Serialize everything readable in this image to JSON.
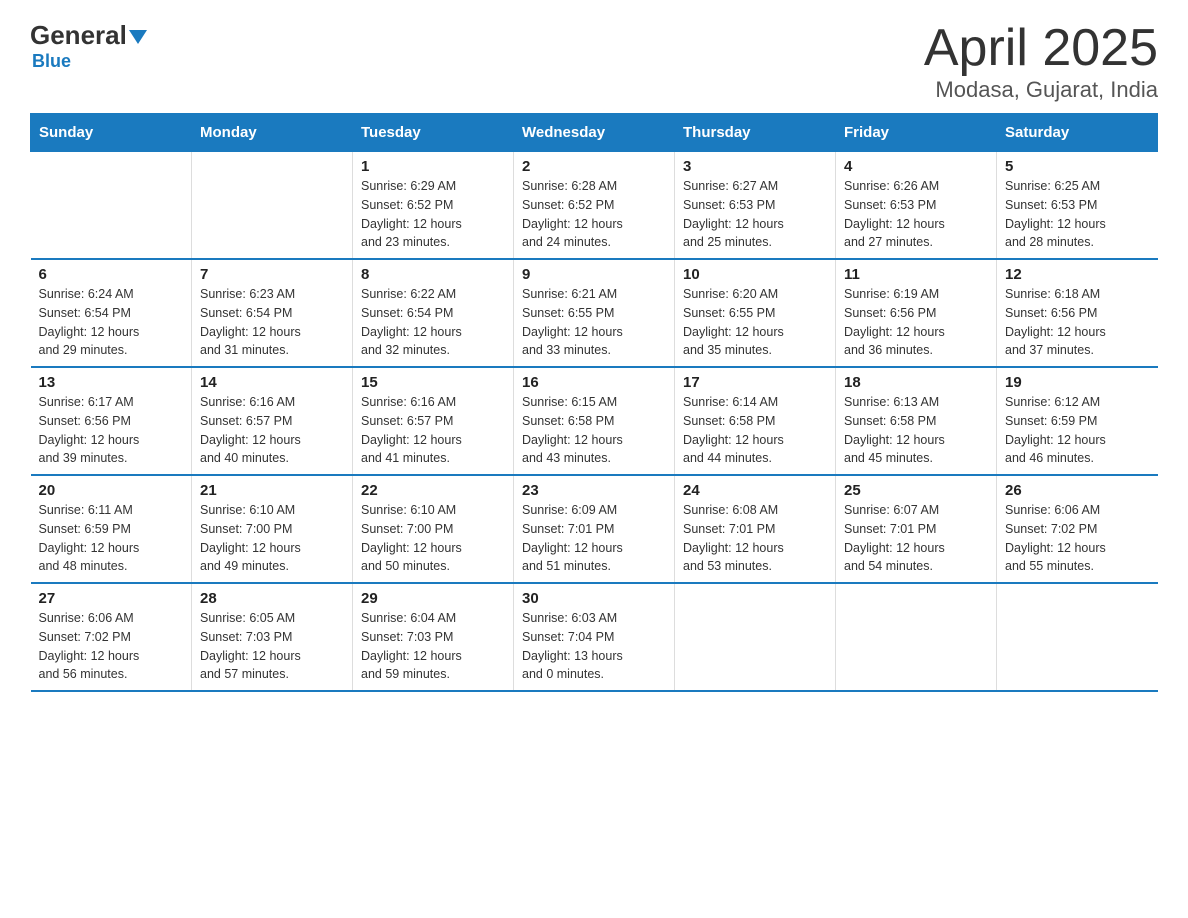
{
  "logo": {
    "general": "General",
    "blue": "Blue",
    "arrow": "▼"
  },
  "header": {
    "title": "April 2025",
    "subtitle": "Modasa, Gujarat, India"
  },
  "columns": [
    "Sunday",
    "Monday",
    "Tuesday",
    "Wednesday",
    "Thursday",
    "Friday",
    "Saturday"
  ],
  "weeks": [
    [
      {
        "day": "",
        "info": ""
      },
      {
        "day": "",
        "info": ""
      },
      {
        "day": "1",
        "info": "Sunrise: 6:29 AM\nSunset: 6:52 PM\nDaylight: 12 hours\nand 23 minutes."
      },
      {
        "day": "2",
        "info": "Sunrise: 6:28 AM\nSunset: 6:52 PM\nDaylight: 12 hours\nand 24 minutes."
      },
      {
        "day": "3",
        "info": "Sunrise: 6:27 AM\nSunset: 6:53 PM\nDaylight: 12 hours\nand 25 minutes."
      },
      {
        "day": "4",
        "info": "Sunrise: 6:26 AM\nSunset: 6:53 PM\nDaylight: 12 hours\nand 27 minutes."
      },
      {
        "day": "5",
        "info": "Sunrise: 6:25 AM\nSunset: 6:53 PM\nDaylight: 12 hours\nand 28 minutes."
      }
    ],
    [
      {
        "day": "6",
        "info": "Sunrise: 6:24 AM\nSunset: 6:54 PM\nDaylight: 12 hours\nand 29 minutes."
      },
      {
        "day": "7",
        "info": "Sunrise: 6:23 AM\nSunset: 6:54 PM\nDaylight: 12 hours\nand 31 minutes."
      },
      {
        "day": "8",
        "info": "Sunrise: 6:22 AM\nSunset: 6:54 PM\nDaylight: 12 hours\nand 32 minutes."
      },
      {
        "day": "9",
        "info": "Sunrise: 6:21 AM\nSunset: 6:55 PM\nDaylight: 12 hours\nand 33 minutes."
      },
      {
        "day": "10",
        "info": "Sunrise: 6:20 AM\nSunset: 6:55 PM\nDaylight: 12 hours\nand 35 minutes."
      },
      {
        "day": "11",
        "info": "Sunrise: 6:19 AM\nSunset: 6:56 PM\nDaylight: 12 hours\nand 36 minutes."
      },
      {
        "day": "12",
        "info": "Sunrise: 6:18 AM\nSunset: 6:56 PM\nDaylight: 12 hours\nand 37 minutes."
      }
    ],
    [
      {
        "day": "13",
        "info": "Sunrise: 6:17 AM\nSunset: 6:56 PM\nDaylight: 12 hours\nand 39 minutes."
      },
      {
        "day": "14",
        "info": "Sunrise: 6:16 AM\nSunset: 6:57 PM\nDaylight: 12 hours\nand 40 minutes."
      },
      {
        "day": "15",
        "info": "Sunrise: 6:16 AM\nSunset: 6:57 PM\nDaylight: 12 hours\nand 41 minutes."
      },
      {
        "day": "16",
        "info": "Sunrise: 6:15 AM\nSunset: 6:58 PM\nDaylight: 12 hours\nand 43 minutes."
      },
      {
        "day": "17",
        "info": "Sunrise: 6:14 AM\nSunset: 6:58 PM\nDaylight: 12 hours\nand 44 minutes."
      },
      {
        "day": "18",
        "info": "Sunrise: 6:13 AM\nSunset: 6:58 PM\nDaylight: 12 hours\nand 45 minutes."
      },
      {
        "day": "19",
        "info": "Sunrise: 6:12 AM\nSunset: 6:59 PM\nDaylight: 12 hours\nand 46 minutes."
      }
    ],
    [
      {
        "day": "20",
        "info": "Sunrise: 6:11 AM\nSunset: 6:59 PM\nDaylight: 12 hours\nand 48 minutes."
      },
      {
        "day": "21",
        "info": "Sunrise: 6:10 AM\nSunset: 7:00 PM\nDaylight: 12 hours\nand 49 minutes."
      },
      {
        "day": "22",
        "info": "Sunrise: 6:10 AM\nSunset: 7:00 PM\nDaylight: 12 hours\nand 50 minutes."
      },
      {
        "day": "23",
        "info": "Sunrise: 6:09 AM\nSunset: 7:01 PM\nDaylight: 12 hours\nand 51 minutes."
      },
      {
        "day": "24",
        "info": "Sunrise: 6:08 AM\nSunset: 7:01 PM\nDaylight: 12 hours\nand 53 minutes."
      },
      {
        "day": "25",
        "info": "Sunrise: 6:07 AM\nSunset: 7:01 PM\nDaylight: 12 hours\nand 54 minutes."
      },
      {
        "day": "26",
        "info": "Sunrise: 6:06 AM\nSunset: 7:02 PM\nDaylight: 12 hours\nand 55 minutes."
      }
    ],
    [
      {
        "day": "27",
        "info": "Sunrise: 6:06 AM\nSunset: 7:02 PM\nDaylight: 12 hours\nand 56 minutes."
      },
      {
        "day": "28",
        "info": "Sunrise: 6:05 AM\nSunset: 7:03 PM\nDaylight: 12 hours\nand 57 minutes."
      },
      {
        "day": "29",
        "info": "Sunrise: 6:04 AM\nSunset: 7:03 PM\nDaylight: 12 hours\nand 59 minutes."
      },
      {
        "day": "30",
        "info": "Sunrise: 6:03 AM\nSunset: 7:04 PM\nDaylight: 13 hours\nand 0 minutes."
      },
      {
        "day": "",
        "info": ""
      },
      {
        "day": "",
        "info": ""
      },
      {
        "day": "",
        "info": ""
      }
    ]
  ]
}
